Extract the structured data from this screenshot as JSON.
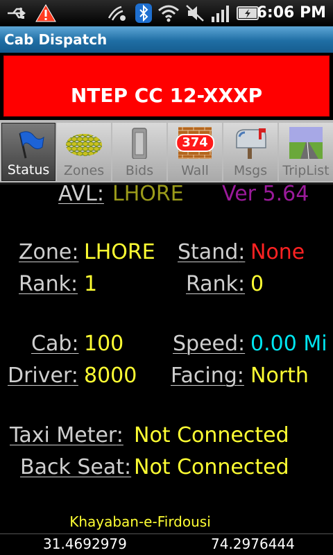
{
  "status_bar": {
    "time": "6:06 PM",
    "icons": [
      "usb-icon",
      "warning-icon",
      "nfc-icon",
      "bluetooth-icon",
      "wifi-icon",
      "mute-icon",
      "signal-icon",
      "battery-icon"
    ]
  },
  "app": {
    "title": "Cab Dispatch"
  },
  "banner": {
    "text": "NTEP CC 12-XXXP",
    "color": "#ff0000"
  },
  "tabs": [
    {
      "label": "Status",
      "icon": "flag-icon",
      "active": true
    },
    {
      "label": "Zones",
      "icon": "honeycomb-icon",
      "active": false
    },
    {
      "label": "Bids",
      "icon": "bid-frame-icon",
      "active": false
    },
    {
      "label": "Wall",
      "icon": "brick-wall-icon",
      "active": false,
      "badge": "374"
    },
    {
      "label": "Msgs",
      "icon": "mailbox-icon",
      "active": false
    },
    {
      "label": "TripList",
      "icon": "road-icon",
      "active": false
    }
  ],
  "status": {
    "avl_label": "AVL",
    "avl_value": "LHORE",
    "version": "Ver 5.64",
    "zone_label": "Zone",
    "zone_value": "LHORE",
    "stand_label": "Stand",
    "stand_value": "None",
    "zone_rank_label": "Rank",
    "zone_rank_value": "1",
    "stand_rank_label": "Rank",
    "stand_rank_value": "0",
    "cab_label": "Cab",
    "cab_value": "100",
    "speed_label": "Speed",
    "speed_value": "0.00 Mi",
    "driver_label": "Driver",
    "driver_value": "8000",
    "facing_label": "Facing",
    "facing_value": "North",
    "taxi_meter_label": "Taxi Meter",
    "taxi_meter_value": "Not Connected",
    "back_seat_label": "Back Seat",
    "back_seat_value": "Not Connected"
  },
  "footer": {
    "street": "Khayaban-e-Firdousi",
    "latitude": "31.4692979",
    "longitude": "74.2976444"
  },
  "colors": {
    "accent_yellow": "#ffff33",
    "alert_red": "#ff2222",
    "cyan": "#00e5f0",
    "title_blue": "#1f6ea4"
  }
}
